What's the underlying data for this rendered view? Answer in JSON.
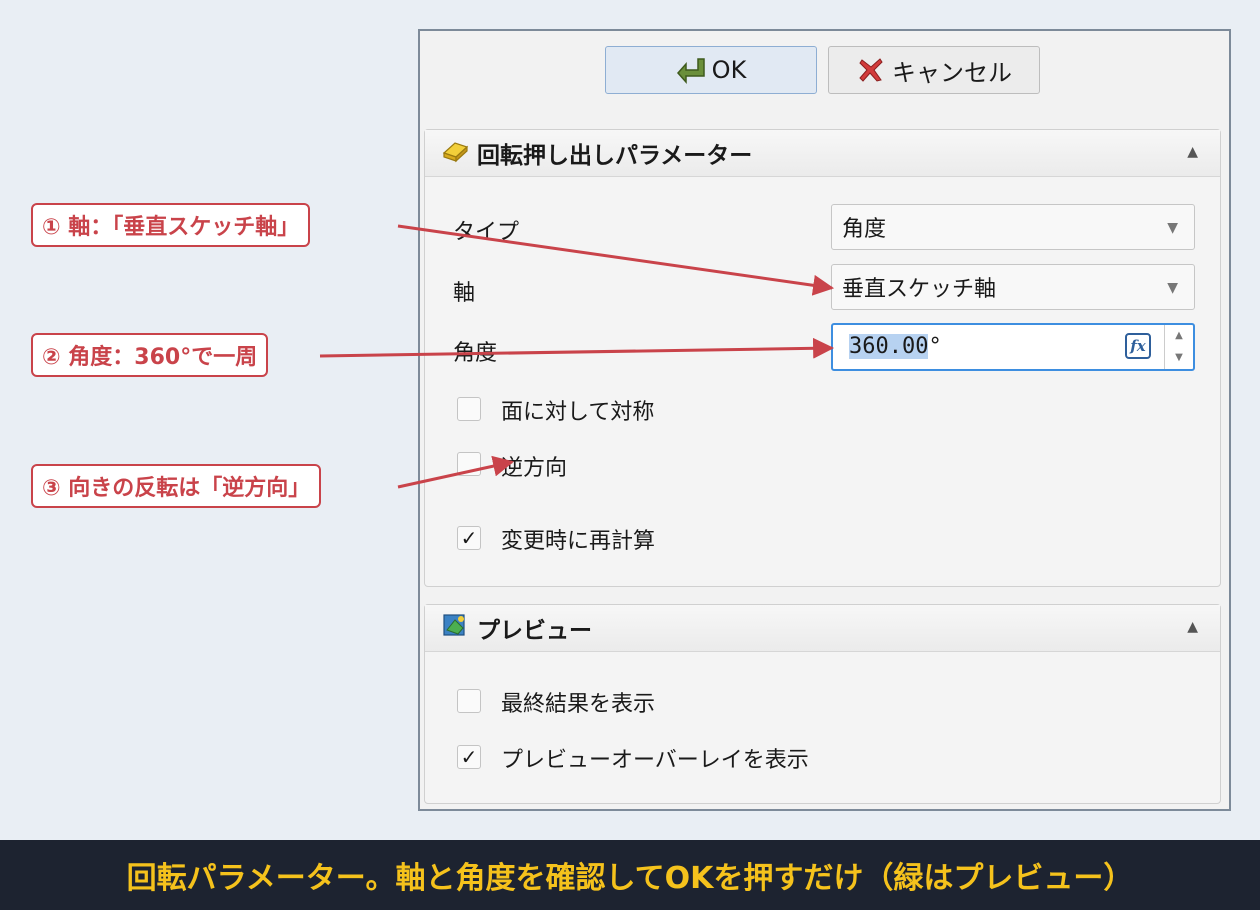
{
  "buttons": {
    "ok": "OK",
    "cancel": "キャンセル"
  },
  "section_revolve": {
    "title": "回転押し出しパラメーター",
    "type_label": "タイプ",
    "type_value": "角度",
    "axis_label": "軸",
    "axis_value": "垂直スケッチ軸",
    "angle_label": "角度",
    "angle_value": "360.00",
    "angle_unit": "°",
    "symmetric_label": "面に対して対称",
    "symmetric_checked": false,
    "reversed_label": "逆方向",
    "reversed_checked": false,
    "recompute_label": "変更時に再計算",
    "recompute_checked": true,
    "check_mark": "✓"
  },
  "section_preview": {
    "title": "プレビュー",
    "final_label": "最終結果を表示",
    "final_checked": false,
    "overlay_label": "プレビューオーバーレイを表示",
    "overlay_checked": true,
    "check_mark": "✓"
  },
  "callouts": {
    "c1": "① 軸：「垂直スケッチ軸」",
    "c2": "② 角度：360°で一周",
    "c3": "③ 向きの反転は「逆方向」"
  },
  "caption": "回転パラメーター。軸と角度を確認してOKを押すだけ（緑はプレビュー）",
  "colors": {
    "accent_red": "#c9434a",
    "caption_yellow": "#f5c21c",
    "footer_bg": "#1d2330",
    "focus_blue": "#3d8ee0"
  }
}
